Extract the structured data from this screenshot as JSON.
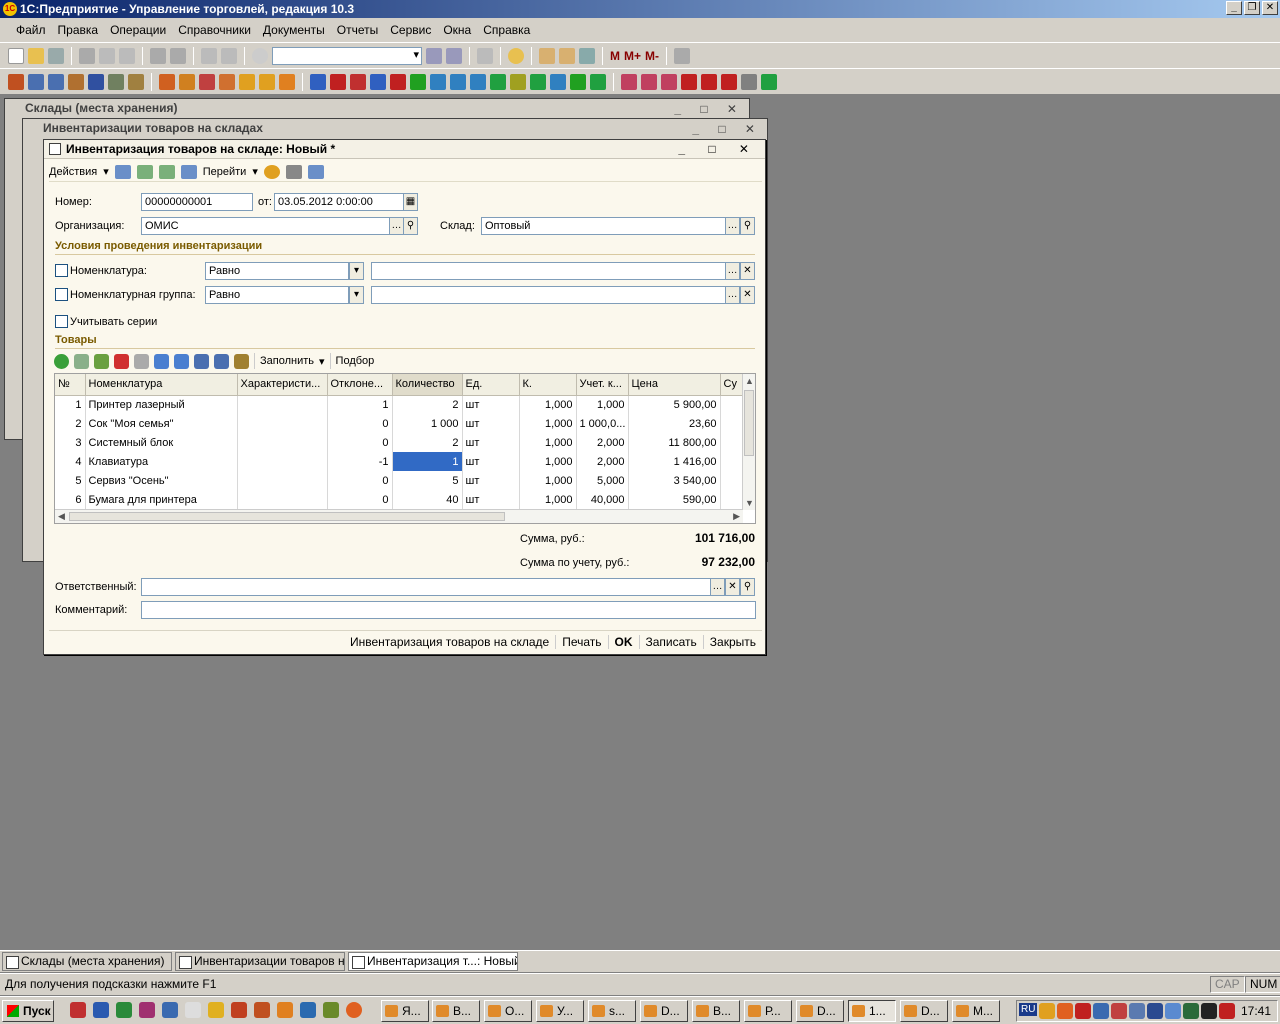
{
  "app": {
    "title": "1С:Предприятие - Управление торговлей, редакция 10.3",
    "menu": [
      "Файл",
      "Правка",
      "Операции",
      "Справочники",
      "Документы",
      "Отчеты",
      "Сервис",
      "Окна",
      "Справка"
    ],
    "toolbar_m": [
      "M",
      "M+",
      "M-"
    ]
  },
  "bg_windows": {
    "warehouses_title": "Склады (места хранения)",
    "inventories_title": "Инвентаризации товаров на складах"
  },
  "doc": {
    "title": "Инвентаризация товаров на складе: Новый *",
    "actions_label": "Действия",
    "goto_label": "Перейти",
    "number_label": "Номер:",
    "number_value": "00000000001",
    "date_label": "от:",
    "date_value": "03.05.2012  0:00:00",
    "org_label": "Организация:",
    "org_value": "ОМИС",
    "warehouse_label": "Склад:",
    "warehouse_value": "Оптовый",
    "conditions_title": "Условия проведения инвентаризации",
    "nom_label": "Номенклатура:",
    "nom_cond": "Равно",
    "nom_group_label": "Номенклатурная группа:",
    "nom_group_cond": "Равно",
    "series_label": "Учитывать серии",
    "goods_title": "Товары",
    "fill_label": "Заполнить",
    "pick_label": "Подбор",
    "columns": [
      "№",
      "Номенклатура",
      "Характеристи...",
      "Отклоне...",
      "Количество",
      "Ед.",
      "К.",
      "Учет. к...",
      "Цена",
      "Су"
    ],
    "rows": [
      [
        "1",
        "Принтер лазерный",
        "",
        "1",
        "2",
        "шт",
        "1,000",
        "1,000",
        "5 900,00"
      ],
      [
        "2",
        "Сок \"Моя семья\"",
        "",
        "0",
        "1 000",
        "шт",
        "1,000",
        "1 000,0...",
        "23,60"
      ],
      [
        "3",
        "Системный блок",
        "",
        "0",
        "2",
        "шт",
        "1,000",
        "2,000",
        "11 800,00"
      ],
      [
        "4",
        "Клавиатура",
        "",
        "-1",
        "1",
        "шт",
        "1,000",
        "2,000",
        "1 416,00"
      ],
      [
        "5",
        "Сервиз \"Осень\"",
        "",
        "0",
        "5",
        "шт",
        "1,000",
        "5,000",
        "3 540,00"
      ],
      [
        "6",
        "Бумага для принтера",
        "",
        "0",
        "40",
        "шт",
        "1,000",
        "40,000",
        "590,00"
      ]
    ],
    "sum_label": "Сумма, руб.:",
    "sum_value": "101 716,00",
    "sum_acc_label": "Сумма по учету, руб.:",
    "sum_acc_value": "97 232,00",
    "resp_label": "Ответственный:",
    "comment_label": "Комментарий:",
    "bottom": [
      "Инвентаризация товаров на складе",
      "Печать",
      "OK",
      "Записать",
      "Закрыть"
    ]
  },
  "tabs": [
    "Склады (места хранения)",
    "Инвентаризации товаров н...",
    "Инвентаризация т...: Новый *"
  ],
  "status": {
    "hint": "Для получения подсказки нажмите F1",
    "cap": "CAP",
    "num": "NUM"
  },
  "taskbar": {
    "start": "Пуск",
    "items": [
      "Я...",
      "В...",
      "О...",
      "У...",
      "s...",
      "D...",
      "В...",
      "Р...",
      "D...",
      "1...",
      "D...",
      "M..."
    ],
    "lang": "RU",
    "clock": "17:41"
  }
}
